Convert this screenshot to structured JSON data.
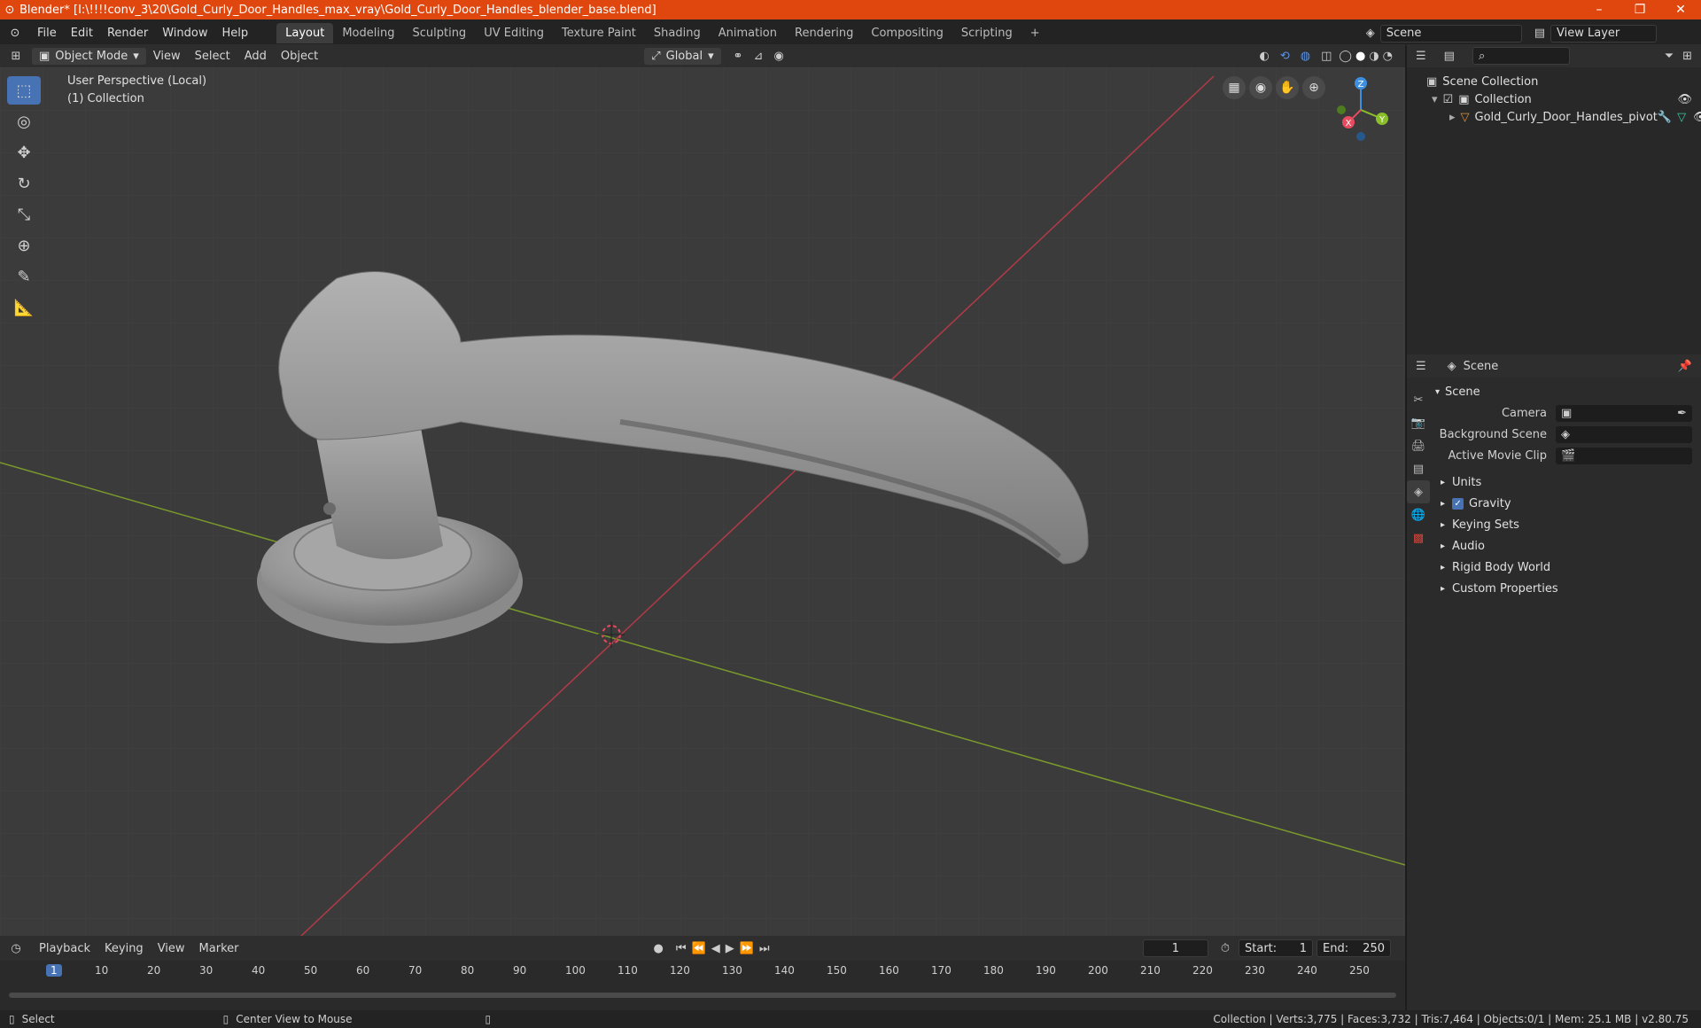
{
  "window": {
    "title": "Blender* [I:\\!!!!conv_3\\20\\Gold_Curly_Door_Handles_max_vray\\Gold_Curly_Door_Handles_blender_base.blend]",
    "minimize": "–",
    "restore": "❐",
    "close": "✕"
  },
  "menu": {
    "items": [
      "File",
      "Edit",
      "Render",
      "Window",
      "Help"
    ]
  },
  "workspaces": {
    "tabs": [
      "Layout",
      "Modeling",
      "Sculpting",
      "UV Editing",
      "Texture Paint",
      "Shading",
      "Animation",
      "Rendering",
      "Compositing",
      "Scripting"
    ],
    "active": "Layout",
    "add": "+"
  },
  "scene_selector": {
    "value": "Scene"
  },
  "view_layer": {
    "value": "View Layer"
  },
  "viewport_header": {
    "mode": "Object Mode",
    "menus": [
      "View",
      "Select",
      "Add",
      "Object"
    ],
    "transform_orientation": "Global"
  },
  "viewport": {
    "perspective_label": "User Perspective (Local)",
    "collection_label": "(1) Collection",
    "gizmo_axes": {
      "x": "X",
      "y": "Y",
      "z": "Z"
    }
  },
  "outliner": {
    "root": "Scene Collection",
    "collection": "Collection",
    "object": "Gold_Curly_Door_Handles_pivot"
  },
  "properties": {
    "context_name": "Scene",
    "section": "Scene",
    "fields": [
      {
        "label": "Camera"
      },
      {
        "label": "Background Scene"
      },
      {
        "label": "Active Movie Clip"
      }
    ],
    "panels": [
      "Units",
      "Gravity",
      "Keying Sets",
      "Audio",
      "Rigid Body World",
      "Custom Properties"
    ],
    "gravity_checked": true
  },
  "timeline": {
    "menus": [
      "Playback",
      "Keying",
      "View",
      "Marker"
    ],
    "current_frame": "1",
    "start_label": "Start:",
    "start": "1",
    "end_label": "End:",
    "end": "250",
    "ticks": [
      "1",
      "10",
      "20",
      "30",
      "40",
      "50",
      "60",
      "70",
      "80",
      "90",
      "100",
      "110",
      "120",
      "130",
      "140",
      "150",
      "160",
      "170",
      "180",
      "190",
      "200",
      "210",
      "220",
      "230",
      "240",
      "250"
    ]
  },
  "statusbar": {
    "select": "Select",
    "center": "Center View to Mouse",
    "stats": "Collection | Verts:3,775 | Faces:3,732 | Tris:7,464 | Objects:0/1 | Mem: 25.1 MB | v2.80.75"
  },
  "colors": {
    "title_bar": "#e0470f",
    "accent": "#4772b3",
    "axis_x": "#e84a5f",
    "axis_y": "#8bbf2a",
    "axis_z": "#3f8fe0"
  }
}
